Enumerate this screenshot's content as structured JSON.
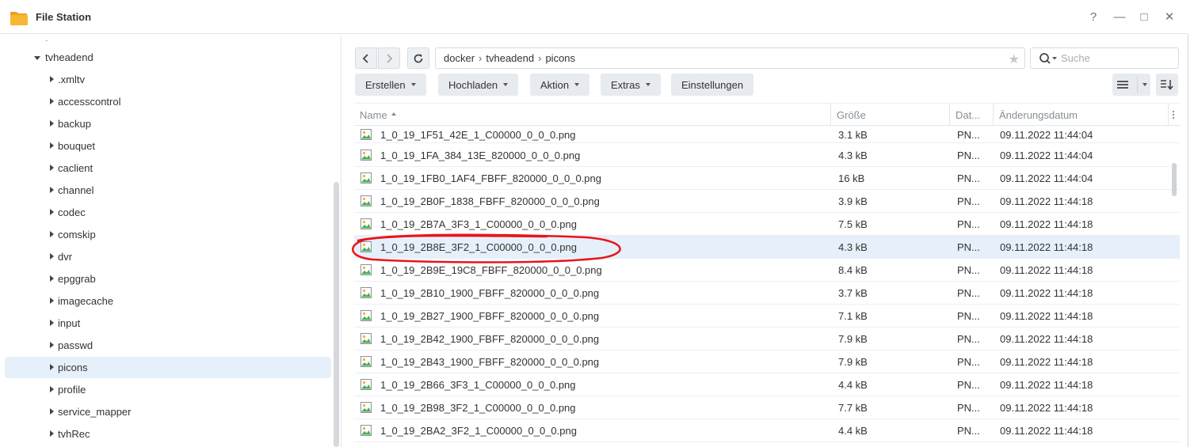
{
  "window": {
    "title": "File Station",
    "controls": [
      "?",
      "—",
      "□",
      "✕"
    ]
  },
  "sidebar": {
    "ellipsis": ".",
    "parent": "tvheadend",
    "children": [
      ".xmltv",
      "accesscontrol",
      "backup",
      "bouquet",
      "caclient",
      "channel",
      "codec",
      "comskip",
      "dvr",
      "epggrab",
      "imagecache",
      "input",
      "passwd",
      "picons",
      "profile",
      "service_mapper",
      "tvhRec"
    ],
    "selected": "picons"
  },
  "toolbar": {
    "path": [
      "docker",
      "tvheadend",
      "picons"
    ],
    "path_separator": "›",
    "search_placeholder": "Suche",
    "actions": [
      "Erstellen",
      "Hochladen",
      "Aktion",
      "Extras",
      "Einstellungen"
    ]
  },
  "table": {
    "columns": [
      "Name",
      "Größe",
      "Dat...",
      "Änderungsdatum"
    ],
    "rows": [
      {
        "name": "1_0_19_1F51_42E_1_C00000_0_0_0.png",
        "size": "3.1 kB",
        "type": "PN...",
        "date": "09.11.2022 11:44:04"
      },
      {
        "name": "1_0_19_1FA_384_13E_820000_0_0_0.png",
        "size": "4.3 kB",
        "type": "PN...",
        "date": "09.11.2022 11:44:04"
      },
      {
        "name": "1_0_19_1FB0_1AF4_FBFF_820000_0_0_0.png",
        "size": "16 kB",
        "type": "PN...",
        "date": "09.11.2022 11:44:04"
      },
      {
        "name": "1_0_19_2B0F_1838_FBFF_820000_0_0_0.png",
        "size": "3.9 kB",
        "type": "PN...",
        "date": "09.11.2022 11:44:18"
      },
      {
        "name": "1_0_19_2B7A_3F3_1_C00000_0_0_0.png",
        "size": "7.5 kB",
        "type": "PN...",
        "date": "09.11.2022 11:44:18"
      },
      {
        "name": "1_0_19_2B8E_3F2_1_C00000_0_0_0.png",
        "size": "4.3 kB",
        "type": "PN...",
        "date": "09.11.2022 11:44:18"
      },
      {
        "name": "1_0_19_2B9E_19C8_FBFF_820000_0_0_0.png",
        "size": "8.4 kB",
        "type": "PN...",
        "date": "09.11.2022 11:44:18"
      },
      {
        "name": "1_0_19_2B10_1900_FBFF_820000_0_0_0.png",
        "size": "3.7 kB",
        "type": "PN...",
        "date": "09.11.2022 11:44:18"
      },
      {
        "name": "1_0_19_2B27_1900_FBFF_820000_0_0_0.png",
        "size": "7.1 kB",
        "type": "PN...",
        "date": "09.11.2022 11:44:18"
      },
      {
        "name": "1_0_19_2B42_1900_FBFF_820000_0_0_0.png",
        "size": "7.9 kB",
        "type": "PN...",
        "date": "09.11.2022 11:44:18"
      },
      {
        "name": "1_0_19_2B43_1900_FBFF_820000_0_0_0.png",
        "size": "7.9 kB",
        "type": "PN...",
        "date": "09.11.2022 11:44:18"
      },
      {
        "name": "1_0_19_2B66_3F3_1_C00000_0_0_0.png",
        "size": "4.4 kB",
        "type": "PN...",
        "date": "09.11.2022 11:44:18"
      },
      {
        "name": "1_0_19_2B98_3F2_1_C00000_0_0_0.png",
        "size": "7.7 kB",
        "type": "PN...",
        "date": "09.11.2022 11:44:18"
      },
      {
        "name": "1_0_19_2BA2_3F2_1_C00000_0_0_0.png",
        "size": "4.4 kB",
        "type": "PN...",
        "date": "09.11.2022 11:44:18"
      }
    ],
    "selected_row": 5
  },
  "colors": {
    "accent_selection": "#e6f0fa",
    "annotation_circle": "#e8141c",
    "folder_icon": "#f5a623"
  },
  "icons": {
    "app": "folder-icon",
    "file": "image-file-icon",
    "search": "search-icon",
    "favorite": "star-icon"
  }
}
